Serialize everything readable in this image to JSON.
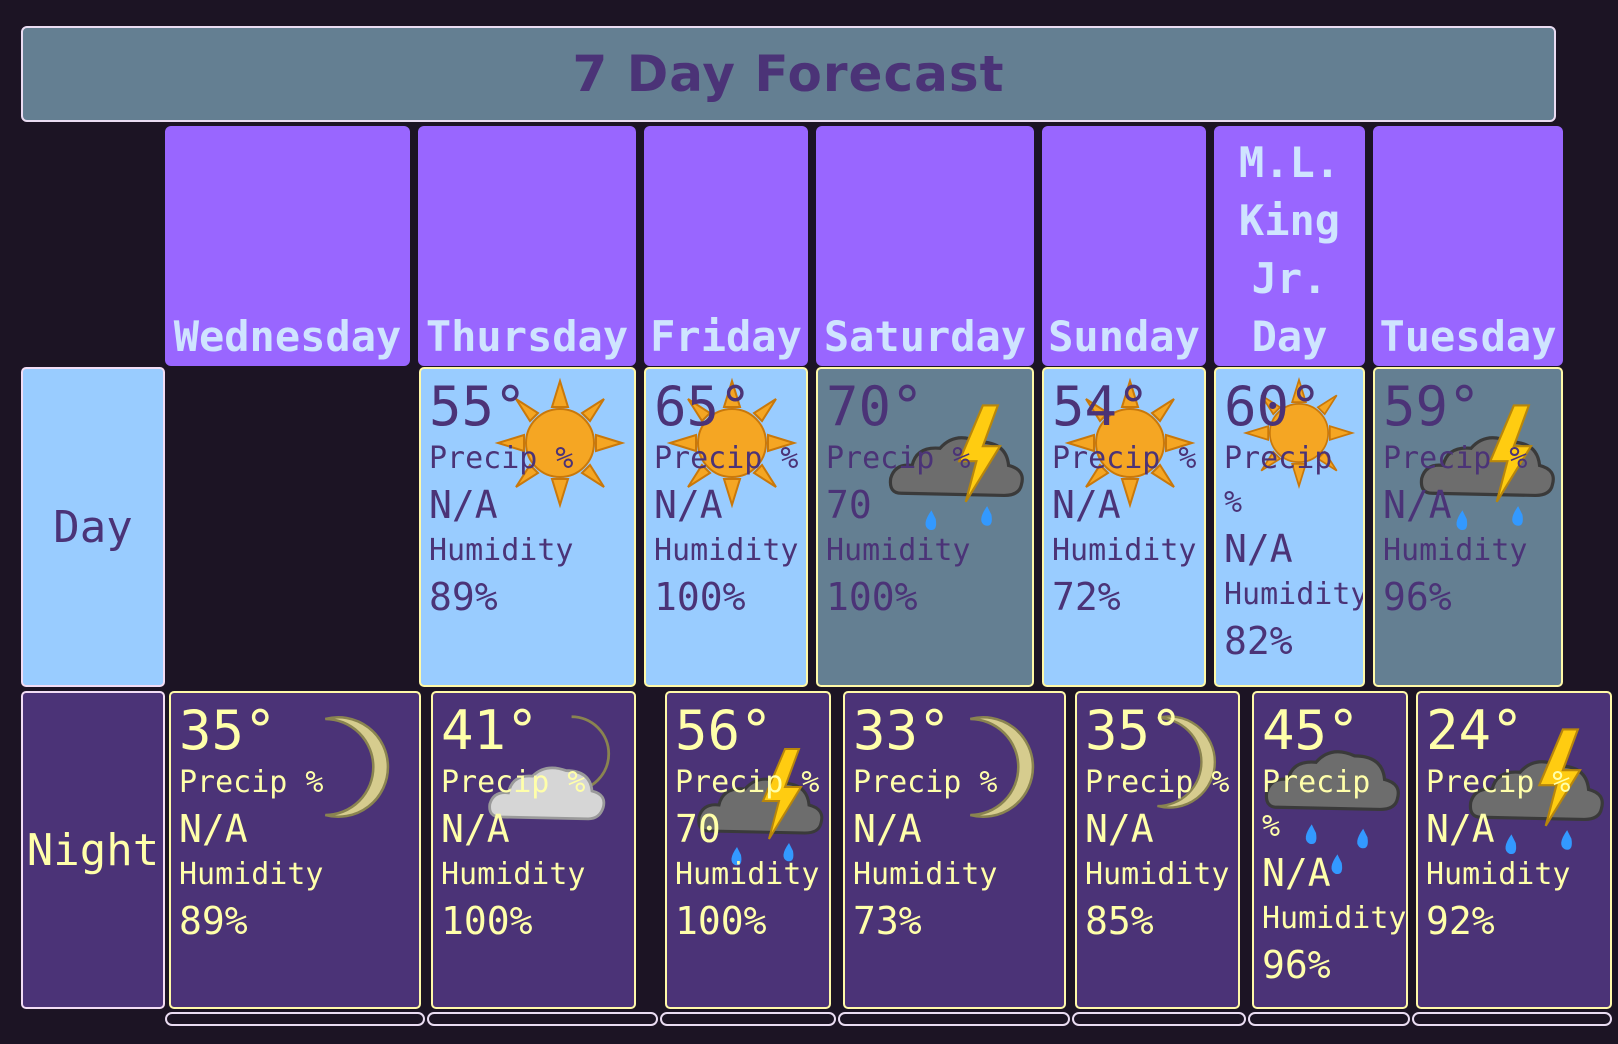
{
  "title": "7 Day Forecast",
  "row_labels": {
    "day": "Day",
    "night": "Night"
  },
  "days": [
    {
      "name": "Wednesday",
      "night": {
        "temp": "35°",
        "precip_label": "Precip %",
        "precip": "N/A",
        "humidity_label": "Humidity",
        "humidity": "89%",
        "icon": "moon-icon"
      }
    },
    {
      "name": "Thursday",
      "day": {
        "temp": "55°",
        "precip_label": "Precip %",
        "precip": "N/A",
        "humidity_label": "Humidity",
        "humidity": "89%",
        "icon": "sun-icon"
      },
      "night": {
        "temp": "41°",
        "precip_label": "Precip %",
        "precip": "N/A",
        "humidity_label": "Humidity",
        "humidity": "100%",
        "icon": "moon-cloud-icon"
      }
    },
    {
      "name": "Friday",
      "day": {
        "temp": "65°",
        "precip_label": "Precip %",
        "precip": "N/A",
        "humidity_label": "Humidity",
        "humidity": "100%",
        "icon": "sun-icon"
      },
      "night": {
        "temp": "56°",
        "precip_label": "Precip %",
        "precip": "70",
        "humidity_label": "Humidity",
        "humidity": "100%",
        "icon": "thunderstorm-icon"
      }
    },
    {
      "name": "Saturday",
      "day": {
        "temp": "70°",
        "precip_label": "Precip %",
        "precip": "70",
        "humidity_label": "Humidity",
        "humidity": "100%",
        "icon": "thunderstorm-icon"
      },
      "night": {
        "temp": "33°",
        "precip_label": "Precip %",
        "precip": "N/A",
        "humidity_label": "Humidity",
        "humidity": "73%",
        "icon": "moon-icon"
      }
    },
    {
      "name": "Sunday",
      "day": {
        "temp": "54°",
        "precip_label": "Precip %",
        "precip": "N/A",
        "humidity_label": "Humidity",
        "humidity": "72%",
        "icon": "sun-icon"
      },
      "night": {
        "temp": "35°",
        "precip_label": "Precip %",
        "precip": "N/A",
        "humidity_label": "Humidity",
        "humidity": "85%",
        "icon": "moon-icon"
      }
    },
    {
      "name": "M.L. King Jr. Day",
      "day": {
        "temp": "60°",
        "precip_label": "Precip %",
        "precip": "N/A",
        "humidity_label": "Humidity",
        "humidity": "82%",
        "icon": "sun-icon"
      },
      "night": {
        "temp": "45°",
        "precip_label": "Precip %",
        "precip": "N/A",
        "humidity_label": "Humidity",
        "humidity": "96%",
        "icon": "rain-cloud-icon"
      }
    },
    {
      "name": "Tuesday",
      "day": {
        "temp": "59°",
        "precip_label": "Precip %",
        "precip": "N/A",
        "humidity_label": "Humidity",
        "humidity": "96%",
        "icon": "thunderstorm-icon"
      },
      "night": {
        "temp": "24°",
        "precip_label": "Precip %",
        "precip": "N/A",
        "humidity_label": "Humidity",
        "humidity": "92%",
        "icon": "thunderstorm-icon"
      }
    }
  ],
  "colors": {
    "background": "#1c1424",
    "title_bar": "#647f92",
    "title_text": "#4b3377",
    "day_header": "#9966ff",
    "day_header_text": "#cfe4ff",
    "day_clear": "#99ccff",
    "day_storm": "#647f92",
    "night": "#4b3377",
    "night_text": "#ffffaa",
    "cell_border": "#fff9a8"
  }
}
